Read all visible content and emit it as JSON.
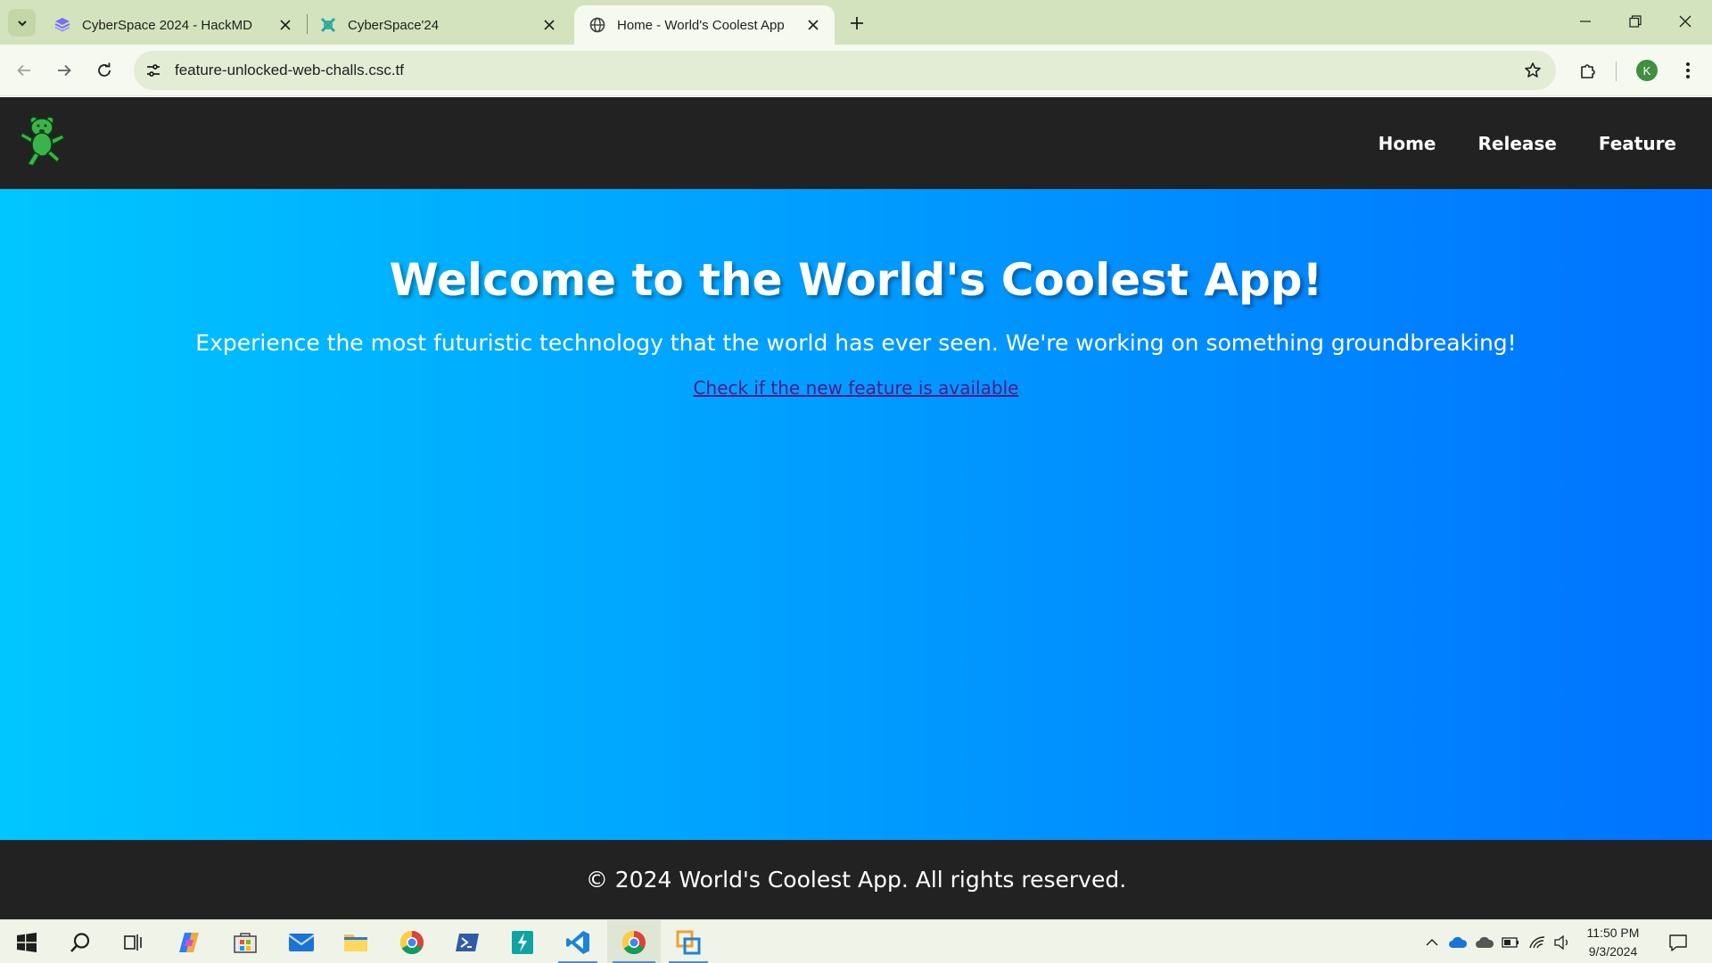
{
  "browser": {
    "tabs": [
      {
        "title": "CyberSpace 2024 - HackMD",
        "favicon": "hackmd-icon",
        "active": false
      },
      {
        "title": "CyberSpace'24",
        "favicon": "cyberspace-icon",
        "active": false
      },
      {
        "title": "Home - World's Coolest App",
        "favicon": "globe-icon",
        "active": true
      }
    ],
    "url": "feature-unlocked-web-challs.csc.tf",
    "profile_initial": "K",
    "accent": "#d3e3bd"
  },
  "site": {
    "nav": {
      "items": [
        "Home",
        "Release",
        "Feature"
      ]
    },
    "hero": {
      "heading": "Welcome to the World's Coolest App!",
      "tagline": "Experience the most futuristic technology that the world has ever seen. We're working on something groundbreaking!",
      "link_text": "Check if the new feature is available"
    },
    "footer": {
      "text": "© 2024 World's Coolest App. All rights reserved."
    },
    "colors": {
      "header_bg": "#222222",
      "gradient_start": "#00c6ff",
      "gradient_end": "#0072ff",
      "link": "#551a8b"
    }
  },
  "taskbar": {
    "apps": [
      "start-icon",
      "search-icon",
      "task-view-icon",
      "copilot-icon",
      "store-icon",
      "mail-icon",
      "file-explorer-icon",
      "chrome-icon",
      "powershell-icon",
      "terminal-icon",
      "vscode-icon",
      "chrome-icon",
      "vmware-icon"
    ],
    "time": "11:50 PM",
    "date": "9/3/2024"
  }
}
